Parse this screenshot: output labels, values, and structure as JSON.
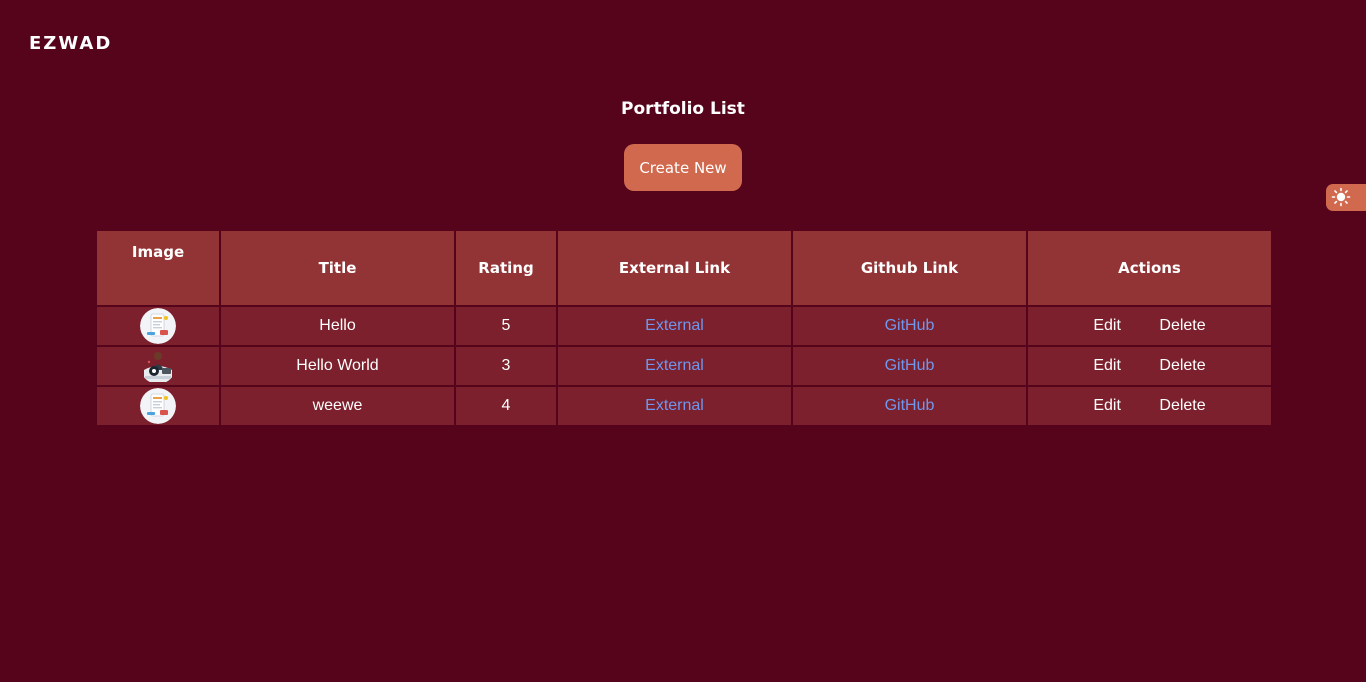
{
  "brand": "EZWAD",
  "page_title": "Portfolio List",
  "create_button": "Create New",
  "theme_toggle_icon": "sun-icon",
  "table": {
    "headers": [
      "Image",
      "Title",
      "Rating",
      "External Link",
      "Github Link",
      "Actions"
    ],
    "rows": [
      {
        "thumb_icon": "portfolio-thumbnail-mockup",
        "title": "Hello",
        "rating": "5",
        "external": "External",
        "github": "GitHub",
        "edit": "Edit",
        "delete": "Delete"
      },
      {
        "thumb_icon": "portfolio-thumbnail-person",
        "title": "Hello World",
        "rating": "3",
        "external": "External",
        "github": "GitHub",
        "edit": "Edit",
        "delete": "Delete"
      },
      {
        "thumb_icon": "portfolio-thumbnail-mockup",
        "title": "weewe",
        "rating": "4",
        "external": "External",
        "github": "GitHub",
        "edit": "Edit",
        "delete": "Delete"
      }
    ]
  },
  "colors": {
    "background": "#55041c",
    "accent": "#d0694e",
    "header_cell": "#923436",
    "body_cell": "#7b202c",
    "link": "#6f97ee"
  }
}
